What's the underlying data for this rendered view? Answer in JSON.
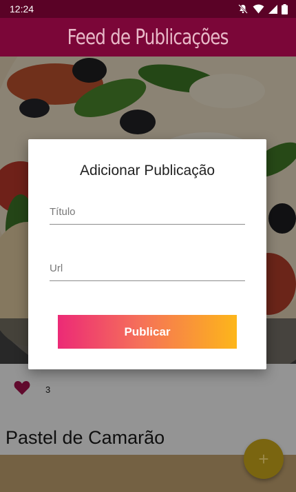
{
  "status_bar": {
    "time": "12:24"
  },
  "app_bar": {
    "title": "Feed de Publicações"
  },
  "post": {
    "image_icon": "pizza-photo",
    "like_icon": "heart-icon",
    "like_count": "3",
    "title": "Pastel de Camarão"
  },
  "dialog": {
    "title": "Adicionar Publicação",
    "title_field_placeholder": "Título",
    "title_field_value": "",
    "url_field_placeholder": "Url",
    "url_field_value": "",
    "publish_label": "Publicar"
  },
  "fab": {
    "label": "+",
    "icon": "add-icon"
  },
  "colors": {
    "status_bar": "#5a0226",
    "app_bar": "#7b0638",
    "heart": "#a8124f",
    "gradient_start": "#ec2a76",
    "gradient_end": "#fdb61a",
    "fab": "#f2c71c"
  }
}
